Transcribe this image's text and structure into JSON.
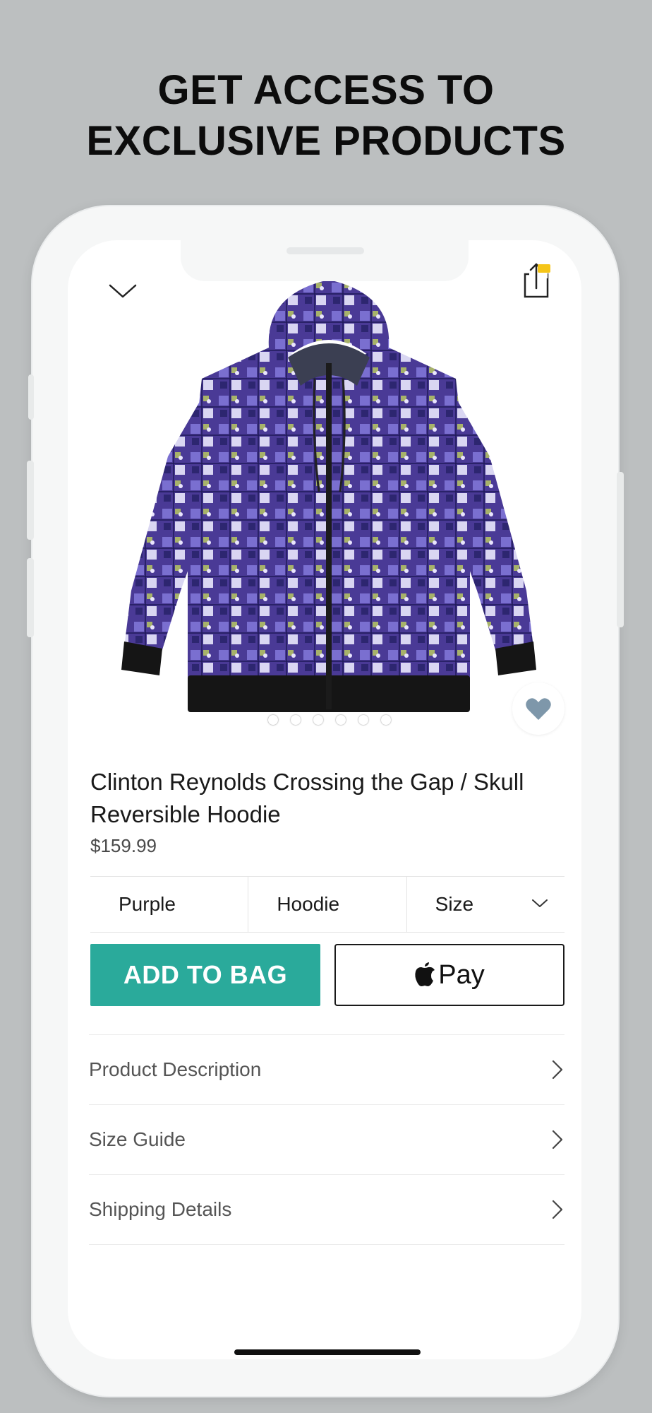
{
  "headline": {
    "line1": "GET ACCESS TO",
    "line2": "EXCLUSIVE PRODUCTS"
  },
  "nav": {
    "back_icon": "chevron-down-icon",
    "share_icon": "share-icon",
    "share_badge_color": "#f5c518"
  },
  "product": {
    "title": "Clinton Reynolds Crossing the Gap / Skull Reversible Hoodie",
    "price": "$159.99",
    "image_count": 6,
    "favorite_icon": "heart-icon"
  },
  "variants": [
    {
      "label": "Purple"
    },
    {
      "label": "Hoodie"
    },
    {
      "label": "Size"
    }
  ],
  "actions": {
    "add_to_bag": "ADD TO BAG",
    "pay_label": "Pay",
    "accent_color": "#2aaa9b"
  },
  "details": [
    {
      "label": "Product Description"
    },
    {
      "label": "Size Guide"
    },
    {
      "label": "Shipping Details"
    }
  ]
}
